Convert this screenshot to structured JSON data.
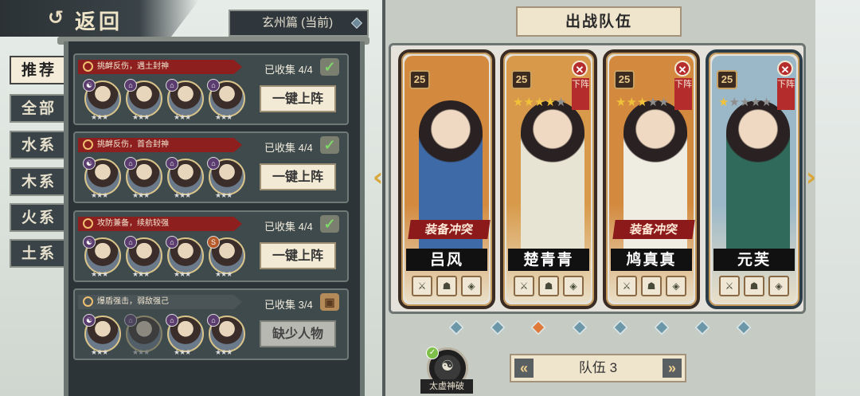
{
  "header": {
    "back_label": "返回",
    "chapter_label": "玄州篇 (当前)"
  },
  "tabs": [
    "推荐",
    "全部",
    "水系",
    "木系",
    "火系",
    "土系"
  ],
  "recommendations": [
    {
      "tag": "挑衅反伤，遇土封神",
      "collected": "已收集 4/4",
      "button": "一键上阵",
      "heroes": [
        {
          "elem": "☯",
          "stars": "★★★"
        },
        {
          "elem": "⌂",
          "stars": "★★★"
        },
        {
          "elem": "⌂",
          "stars": "★★★"
        },
        {
          "elem": "⌂",
          "stars": "★★★"
        }
      ]
    },
    {
      "tag": "挑衅反伤，首合封神",
      "collected": "已收集 4/4",
      "button": "一键上阵",
      "heroes": [
        {
          "elem": "☯",
          "stars": "★★★"
        },
        {
          "elem": "⌂",
          "stars": "★★★"
        },
        {
          "elem": "⌂",
          "stars": "★★★"
        },
        {
          "elem": "⌂",
          "stars": "★★★"
        }
      ]
    },
    {
      "tag": "攻防兼备，续航较强",
      "collected": "已收集 4/4",
      "button": "一键上阵",
      "heroes": [
        {
          "elem": "☯",
          "stars": "★★★"
        },
        {
          "elem": "⌂",
          "stars": "★★★"
        },
        {
          "elem": "⌂",
          "stars": "★★★"
        },
        {
          "elem": "S",
          "stars": "★★★"
        }
      ]
    },
    {
      "tag": "爆盾强击，弱敌强己",
      "collected": "已收集 3/4",
      "button": "缺少人物",
      "heroes": [
        {
          "elem": "☯",
          "stars": "★★★"
        },
        {
          "elem": "⌂",
          "stars": "★★★"
        },
        {
          "elem": "⌂",
          "stars": "★★★"
        },
        {
          "elem": "⌂",
          "stars": "★★★"
        }
      ]
    }
  ],
  "team": {
    "title": "出战队伍",
    "team_label": "队伍 3",
    "skill_label": "太虚神破",
    "conflict_label": "装备冲突",
    "remove_label": "下阵",
    "cards": [
      {
        "name": "吕风",
        "level": "25",
        "stars_on": 0,
        "conflict": true,
        "removable": false,
        "bg": "#d38a3e",
        "robe": "#3f6aa8"
      },
      {
        "name": "楚青青",
        "level": "25",
        "stars_on": 4,
        "conflict": false,
        "removable": true,
        "bg": "#d89a4a",
        "robe": "#e8e4d4"
      },
      {
        "name": "鸠真真",
        "level": "25",
        "stars_on": 3,
        "conflict": true,
        "removable": true,
        "bg": "#d38a3e",
        "robe": "#efece2"
      },
      {
        "name": "元芙",
        "level": "25",
        "stars_on": 1,
        "conflict": false,
        "removable": true,
        "bg": "#9bb8c8",
        "robe": "#2f6a5a"
      }
    ],
    "page_count": 8,
    "active_page": 3
  },
  "colors": {
    "accent_red": "#8e1f1f",
    "gold": "#d9a63a",
    "panel_dark": "#2c3438"
  }
}
